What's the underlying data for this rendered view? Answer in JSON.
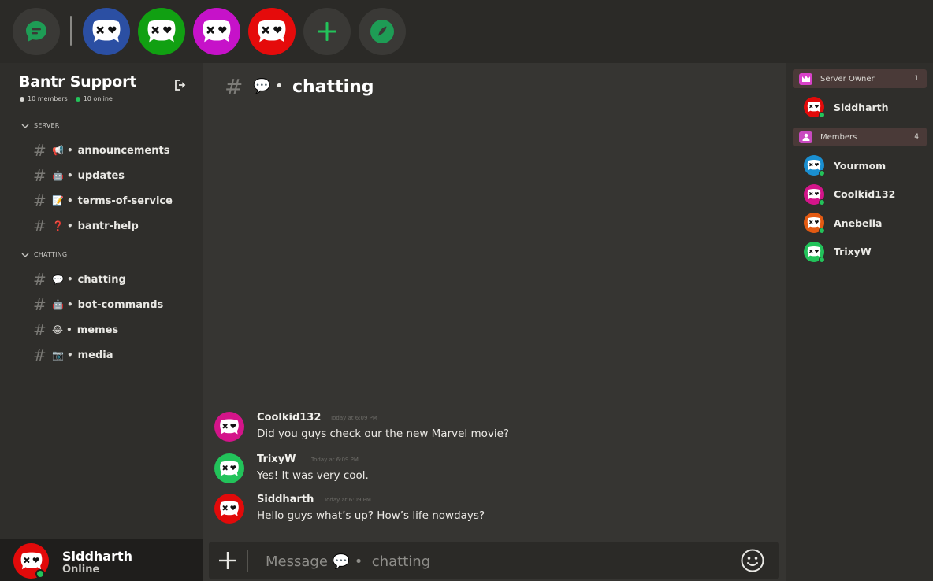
{
  "servers": [
    {
      "name": "server-blue",
      "color": "#2b4fa3"
    },
    {
      "name": "server-green",
      "color": "#11a012"
    },
    {
      "name": "server-purple",
      "color": "#c612c9"
    },
    {
      "name": "server-red",
      "color": "#e50b0b"
    }
  ],
  "colors": {
    "accent_green": "#23c35a",
    "home_icon_green": "#1e9c55"
  },
  "sidebar": {
    "server_name": "Bantr Support",
    "members_count": "10 members",
    "online_count": "10 online",
    "categories": [
      {
        "label": "SERVER",
        "channels": [
          {
            "emoji": "📢",
            "name": "announcements"
          },
          {
            "emoji": "🤖",
            "name": "updates"
          },
          {
            "emoji": "📝",
            "name": "terms-of-service"
          },
          {
            "emoji": "❓",
            "name": "bantr-help"
          }
        ]
      },
      {
        "label": "CHATTING",
        "channels": [
          {
            "emoji": "💬",
            "name": "chatting"
          },
          {
            "emoji": "🤖",
            "name": "bot-commands"
          },
          {
            "emoji": "😂",
            "name": "memes"
          },
          {
            "emoji": "📷",
            "name": "media"
          }
        ]
      }
    ]
  },
  "user": {
    "name": "Siddharth",
    "status": "Online",
    "avatar_color": "#e20a0a"
  },
  "channel": {
    "hash": "#",
    "emoji": "💬",
    "bullet": "•",
    "name": "chatting"
  },
  "messages": [
    {
      "author": "Coolkid132",
      "time": "Today at 6:09 PM",
      "text": "Did you guys check our the new Marvel movie?",
      "avatar_color": "#d4148a"
    },
    {
      "author": "TrixyW",
      "time": "Today at 6:09 PM",
      "text": "Yes! It was very cool.",
      "avatar_color": "#22c35a"
    },
    {
      "author": "Siddharth",
      "time": "Today at 6:09 PM",
      "text": "Hello guys what’s up? How’s life nowdays?",
      "avatar_color": "#e20a0a"
    }
  ],
  "composer": {
    "placeholder": "Message 💬 •  chatting"
  },
  "members": {
    "owner_label": "Server Owner",
    "owner_count": "1",
    "owner": {
      "name": "Siddharth",
      "color": "#e20a0a"
    },
    "members_label": "Members",
    "members_count": "4",
    "list": [
      {
        "name": "Yourmom",
        "color": "#1a8fd1"
      },
      {
        "name": "Coolkid132",
        "color": "#d4148a"
      },
      {
        "name": "Anebella",
        "color": "#e35a12"
      },
      {
        "name": "TrixyW",
        "color": "#22c35a"
      }
    ]
  }
}
